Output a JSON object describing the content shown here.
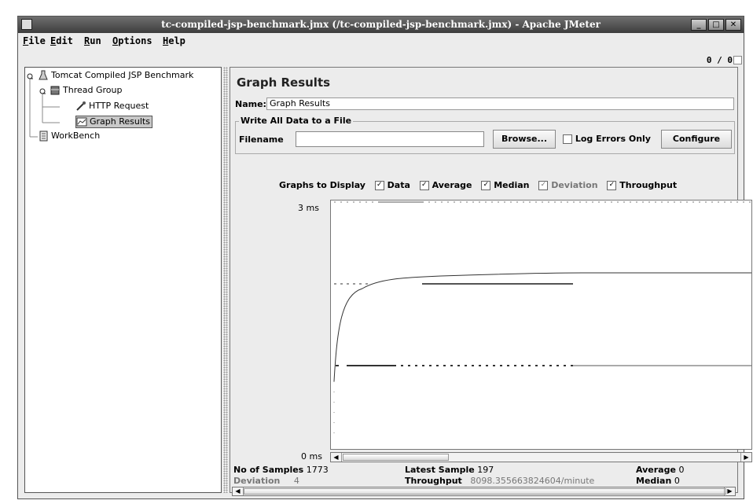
{
  "window": {
    "title": "tc-compiled-jsp-benchmark.jmx (/tc-compiled-jsp-benchmark.jmx) - Apache JMeter",
    "controls": [
      "_",
      "□",
      "✕"
    ]
  },
  "menu": [
    {
      "label": "File",
      "mnemonic": "F",
      "rest": "ile"
    },
    {
      "label": "Edit",
      "mnemonic": "E",
      "rest": "dit"
    },
    {
      "label": "Run",
      "mnemonic": "R",
      "rest": "un"
    },
    {
      "label": "Options",
      "mnemonic": "O",
      "rest": "ptions"
    },
    {
      "label": "Help",
      "mnemonic": "H",
      "rest": "elp"
    }
  ],
  "counter": "0 / 0",
  "tree": {
    "root": "Tomcat Compiled JSP Benchmark",
    "thread_group": "Thread Group",
    "http_request": "HTTP Request",
    "graph_results": "Graph Results",
    "workbench": "WorkBench",
    "icons": {
      "root": "flask-icon",
      "thread_group": "spool-icon",
      "http_request": "pipette-icon",
      "graph_results": "graph-icon",
      "workbench": "notepad-icon"
    }
  },
  "panel": {
    "title": "Graph Results",
    "name_label": "Name:",
    "name_value": "Graph Results",
    "write_all_label": "Write All Data to a File",
    "filename_label": "Filename",
    "filename_value": "",
    "browse_button": "Browse...",
    "log_errors_label": "Log Errors Only",
    "log_errors_checked": false,
    "configure_button": "Configure"
  },
  "graphs_to_display": {
    "label": "Graphs to Display",
    "options": [
      {
        "label": "Data",
        "checked": true
      },
      {
        "label": "Average",
        "checked": true
      },
      {
        "label": "Median",
        "checked": true
      },
      {
        "label": "Deviation",
        "checked": true
      },
      {
        "label": "Throughput",
        "checked": true
      }
    ]
  },
  "chart": {
    "y_max_label": "3 ms",
    "y_min_label": "0 ms"
  },
  "stats": {
    "samples_label": "No of Samples",
    "samples_value": "1773",
    "latest_label": "Latest Sample",
    "latest_value": "197",
    "average_label": "Average",
    "average_value": "0",
    "deviation_label": "Deviation",
    "deviation_value": "4",
    "throughput_label": "Throughput",
    "throughput_value": "8098.355663824604/minute",
    "median_label": "Median",
    "median_value": "0"
  }
}
